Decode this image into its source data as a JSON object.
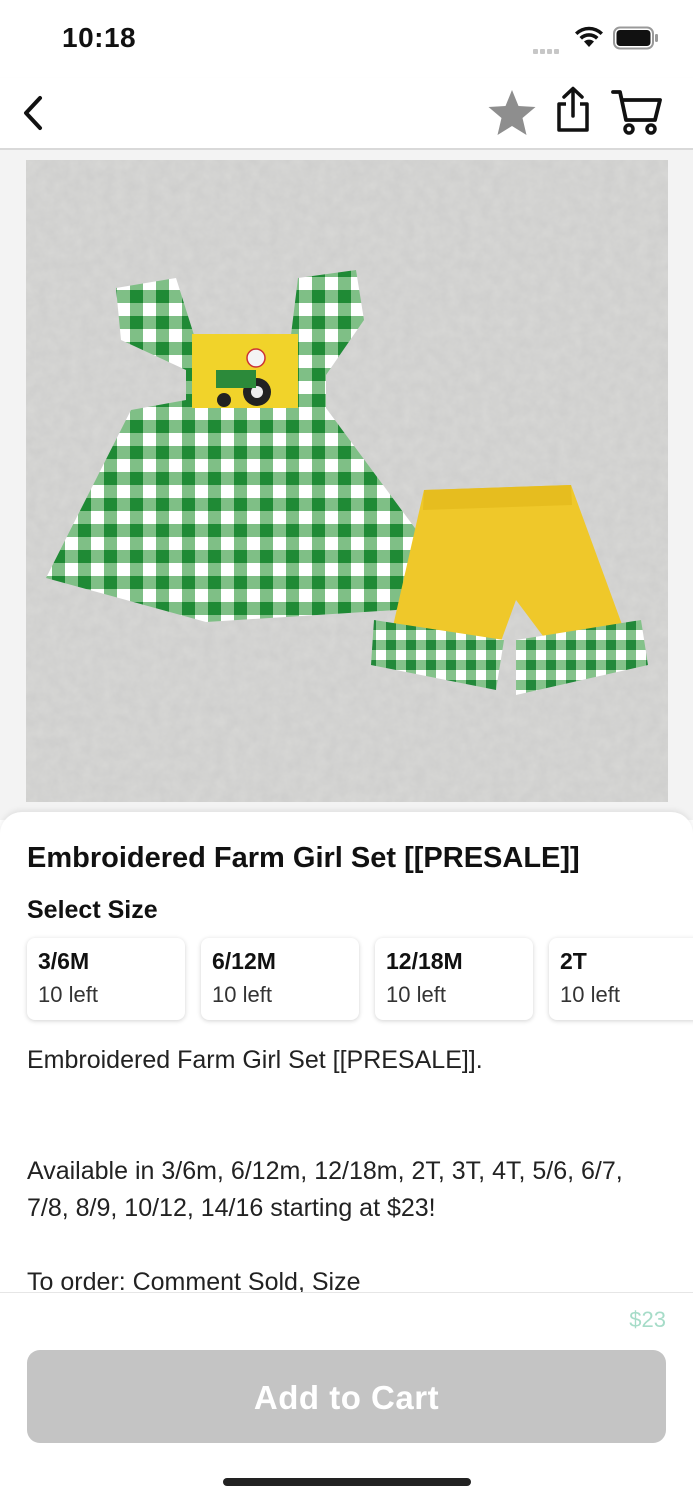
{
  "status_bar": {
    "time": "10:18"
  },
  "nav": {
    "back_icon": "chevron-left-icon",
    "favorite_icon": "star-icon",
    "share_icon": "share-icon",
    "cart_icon": "cart-icon",
    "star_color": "#8e8e8e"
  },
  "product": {
    "title": "Embroidered Farm Girl Set [[PRESALE]]",
    "select_size_label": "Select Size",
    "sizes": [
      {
        "size": "3/6M",
        "stock": "10 left"
      },
      {
        "size": "6/12M",
        "stock": "10 left"
      },
      {
        "size": "12/18M",
        "stock": "10 left"
      },
      {
        "size": "2T",
        "stock": "10 left"
      }
    ],
    "description": {
      "line1": "Embroidered Farm Girl Set [[PRESALE]].",
      "line2": "Available in 3/6m, 6/12m, 12/18m, 2T, 3T, 4T, 5/6, 6/7, 7/8, 8/9, 10/12, 14/16 starting at $23!",
      "line3": "To order: Comment Sold, Size"
    }
  },
  "footer": {
    "price": "$23",
    "add_to_cart_label": "Add to Cart",
    "button_color": "#c4c4c4",
    "price_color": "#a6dcc8"
  }
}
